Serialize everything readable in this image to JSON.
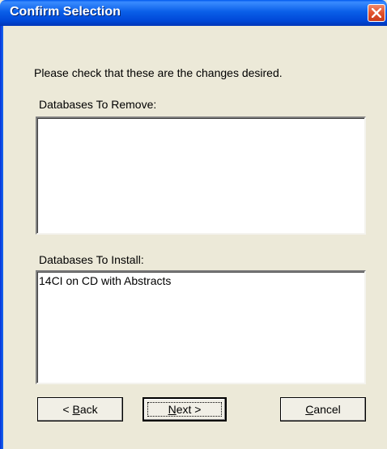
{
  "window": {
    "title": "Confirm Selection"
  },
  "content": {
    "instruction": "Please check that these are the changes desired.",
    "remove_label": "Databases To Remove:",
    "remove_items": [],
    "install_label": "Databases To Install:",
    "install_items": [
      "14CI on CD with Abstracts"
    ]
  },
  "buttons": {
    "back": {
      "prefix": "< ",
      "mnemonic": "B",
      "rest": "ack"
    },
    "next": {
      "prefix": "",
      "mnemonic": "N",
      "rest": "ext >"
    },
    "cancel": {
      "prefix": "",
      "mnemonic": "C",
      "rest": "ancel"
    }
  },
  "icons": {
    "close": "close-icon"
  },
  "colors": {
    "titlebar": "#0a5fe8",
    "close_button": "#e2522d",
    "dialog_background": "#ece9d8"
  }
}
